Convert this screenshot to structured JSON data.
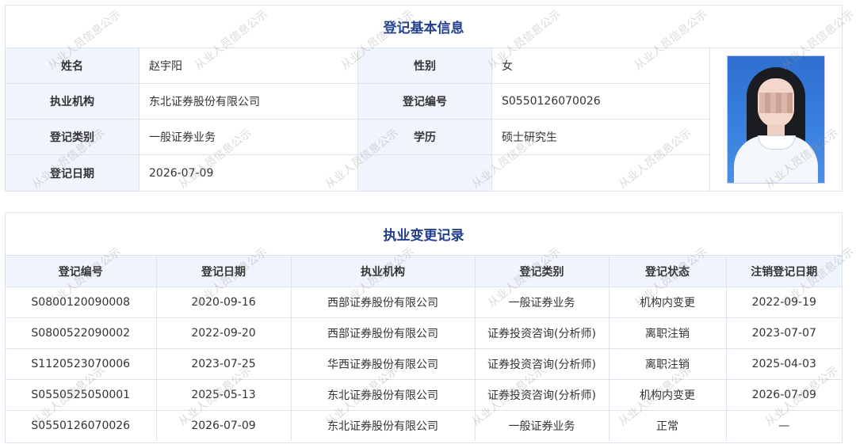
{
  "basic_info": {
    "title": "登记基本信息",
    "name_label": "姓名",
    "name_value": "赵宇阳",
    "gender_label": "性别",
    "gender_value": "女",
    "institution_label": "执业机构",
    "institution_value": "东北证券股份有限公司",
    "reg_no_label": "登记编号",
    "reg_no_value": "S0550126070026",
    "category_label": "登记类别",
    "category_value": "一般证券业务",
    "education_label": "学历",
    "education_value": "硕士研究生",
    "date_label": "登记日期",
    "date_value": "2026-07-09"
  },
  "changes": {
    "title": "执业变更记录",
    "columns": [
      "登记编号",
      "登记日期",
      "执业机构",
      "登记类别",
      "登记状态",
      "注销登记日期"
    ],
    "rows": [
      [
        "S0800120090008",
        "2020-09-16",
        "西部证券股份有限公司",
        "一般证券业务",
        "机构内变更",
        "2022-09-19"
      ],
      [
        "S0800522090002",
        "2022-09-20",
        "西部证券股份有限公司",
        "证券投资咨询(分析师)",
        "离职注销",
        "2023-07-07"
      ],
      [
        "S1120523070006",
        "2023-07-25",
        "华西证券股份有限公司",
        "证券投资咨询(分析师)",
        "离职注销",
        "2025-04-03"
      ],
      [
        "S0550525050001",
        "2025-05-13",
        "东北证券股份有限公司",
        "证券投资咨询(分析师)",
        "机构内变更",
        "2026-07-09"
      ],
      [
        "S0550126070026",
        "2026-07-09",
        "东北证券股份有限公司",
        "一般证券业务",
        "正常",
        "—"
      ]
    ]
  },
  "watermark": "从业人员信息公示",
  "colors": {
    "title": "#23408e",
    "label_bg": "#f0f5fd",
    "border": "#dde3ee"
  }
}
